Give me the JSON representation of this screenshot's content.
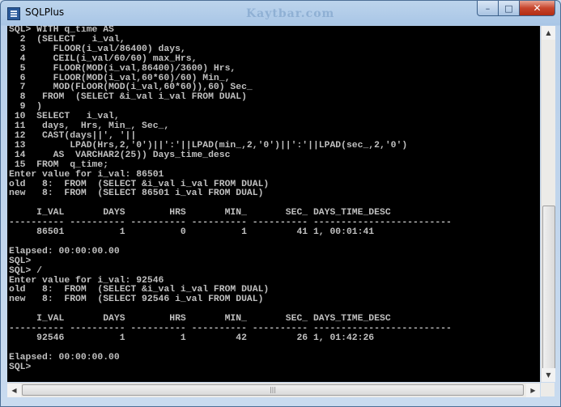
{
  "window": {
    "title": "SQLPlus",
    "watermark": "Kaytbar.com"
  },
  "caption": {
    "minimize": "–",
    "maximize": "□",
    "close": "✕"
  },
  "icons": {
    "app": "sqlplus-app-icon",
    "scroll_up": "▲",
    "scroll_down": "▼",
    "scroll_left": "◀",
    "scroll_right": "▶",
    "thumb_grip": "|||"
  },
  "console": {
    "text": "SQL> WITH q_time AS\n  2  (SELECT   i_val,\n  3     FLOOR(i_val/86400) days,\n  4     CEIL(i_val/60/60) max_Hrs,\n  5     FLOOR(MOD(i_val,86400)/3600) Hrs,\n  6     FLOOR(MOD(i_val,60*60)/60) Min_,\n  7     MOD(FLOOR(MOD(i_val,60*60)),60) Sec_\n  8   FROM  (SELECT &i_val i_val FROM DUAL)\n  9  )\n 10  SELECT   i_val,\n 11   days,  Hrs, Min_, Sec_,\n 12   CAST(days||', '||\n 13        LPAD(Hrs,2,'0')||':'||LPAD(min_,2,'0')||':'||LPAD(sec_,2,'0')\n 14     AS  VARCHAR2(25)) Days_time_desc\n 15  FROM  q_time;\nEnter value for i_val: 86501\nold   8:  FROM  (SELECT &i_val i_val FROM DUAL)\nnew   8:  FROM  (SELECT 86501 i_val FROM DUAL)\n\n     I_VAL       DAYS        HRS       MIN_       SEC_ DAYS_TIME_DESC\n---------- ---------- ---------- ---------- ---------- -------------------------\n     86501          1          0          1         41 1, 00:01:41\n\nElapsed: 00:00:00.00\nSQL>\nSQL> /\nEnter value for i_val: 92546\nold   8:  FROM  (SELECT &i_val i_val FROM DUAL)\nnew   8:  FROM  (SELECT 92546 i_val FROM DUAL)\n\n     I_VAL       DAYS        HRS       MIN_       SEC_ DAYS_TIME_DESC\n---------- ---------- ---------- ---------- ---------- -------------------------\n     92546          1          1         42         26 1, 01:42:26\n\nElapsed: 00:00:00.00\nSQL>"
  }
}
